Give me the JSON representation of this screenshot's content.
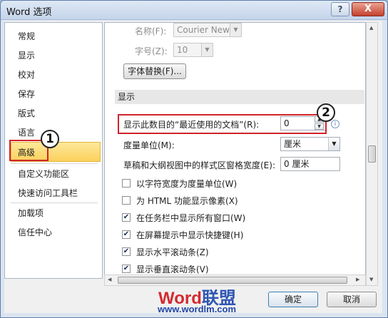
{
  "window": {
    "title": "Word 选项",
    "help_label": "?",
    "close_label": "X"
  },
  "sidebar": {
    "items": [
      "常规",
      "显示",
      "校对",
      "保存",
      "版式",
      "语言",
      "高级",
      "自定义功能区",
      "快速访问工具栏",
      "加载项",
      "信任中心"
    ],
    "selected": "高级"
  },
  "main": {
    "font_name_label": "名称(F):",
    "font_name_value": "Courier New",
    "font_size_label": "字号(Z):",
    "font_size_value": "10",
    "font_sub_button": "字体替换(F)...",
    "section_display": "显示",
    "recent_docs_label": "显示此数目的“最近使用的文档”(R):",
    "recent_docs_value": "0",
    "unit_label": "度量单位(M):",
    "unit_value": "厘米",
    "draft_width_label": "草稿和大纲视图中的样式区窗格宽度(E):",
    "draft_width_value": "0 厘米",
    "checkboxes": [
      {
        "label": "以字符宽度为度量单位(W)",
        "checked": false
      },
      {
        "label": "为 HTML 功能显示像素(X)",
        "checked": false
      },
      {
        "label": "在任务栏中显示所有窗口(W)",
        "checked": true
      },
      {
        "label": "在屏幕提示中显示快捷键(H)",
        "checked": true
      },
      {
        "label": "显示水平滚动条(Z)",
        "checked": true
      },
      {
        "label": "显示垂直滚动条(V)",
        "checked": true
      }
    ]
  },
  "annotations": {
    "step1": "1",
    "step2": "2"
  },
  "watermark": {
    "brand_a": "Word",
    "brand_b": "联盟",
    "url": "www.wordlm.com"
  },
  "footer": {
    "ok_label": "确定",
    "cancel_label": "取消"
  },
  "icons": {
    "check": "✔",
    "info": "i",
    "dropdown": "▼",
    "spin_up": "▲",
    "spin_down": "▼"
  },
  "colors": {
    "accent_red": "#d0232a",
    "selection": "#fbd15c",
    "watermark_blue": "#2f56b4"
  }
}
